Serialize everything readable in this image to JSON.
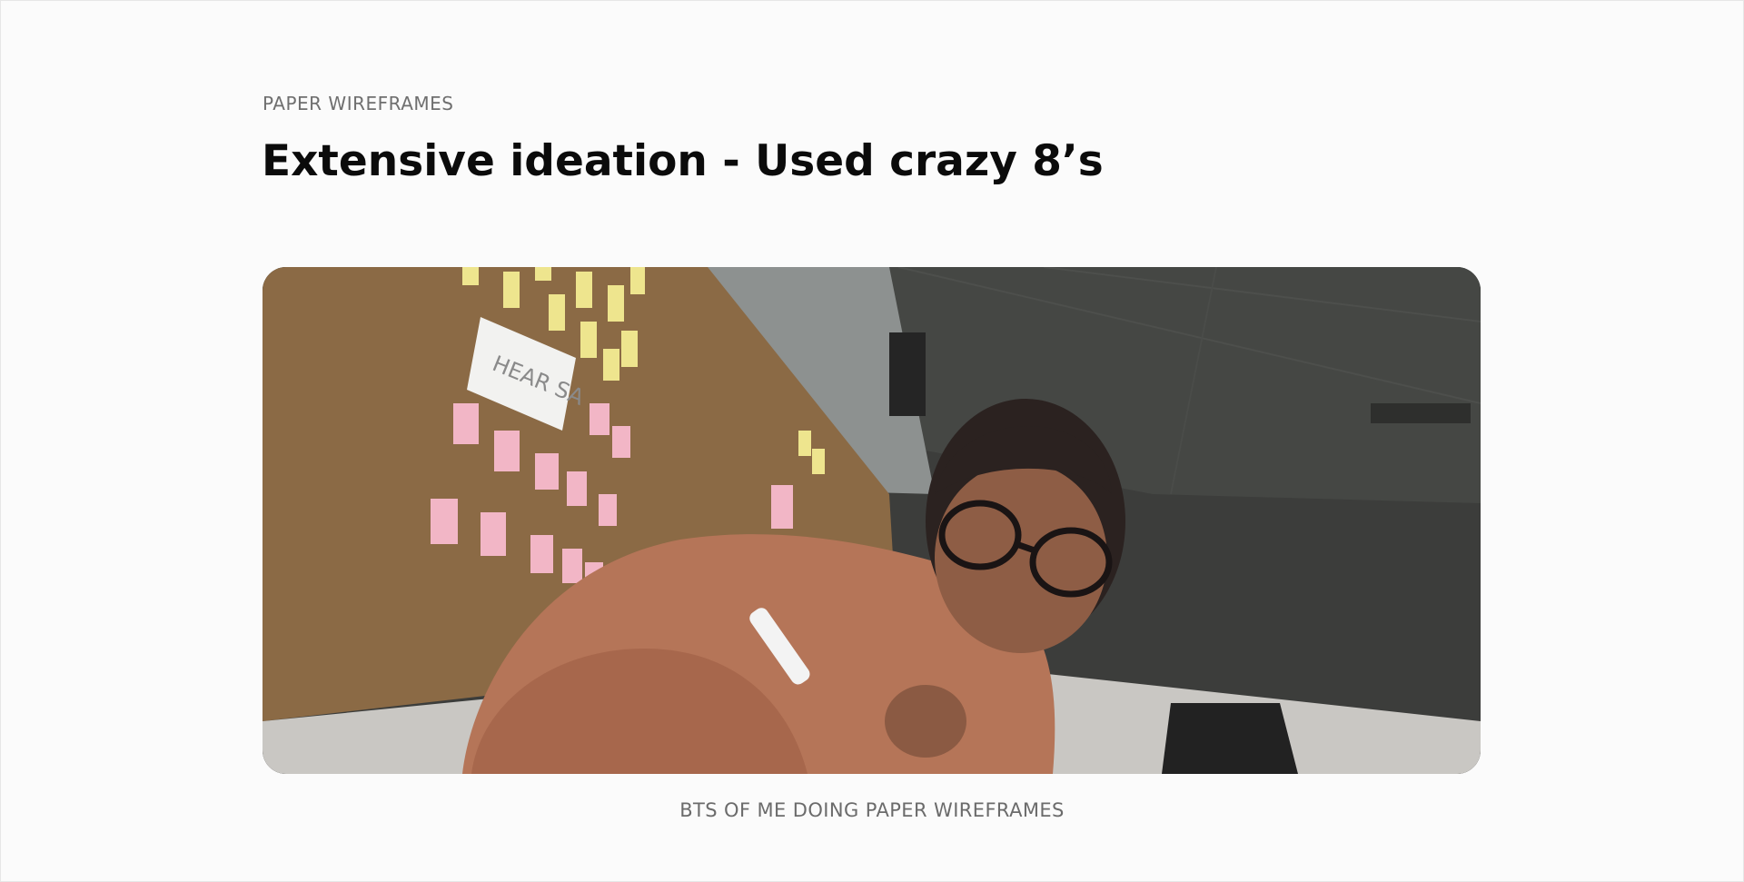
{
  "section": {
    "eyebrow": "PAPER WIREFRAMES",
    "title": "Extensive ideation - Used crazy 8’s"
  },
  "media": {
    "caption": "BTS OF ME DOING PAPER WIREFRAMES",
    "sign_text": "HEAR SA",
    "colors": {
      "corkboard": "#8b6a45",
      "sticky_yellow": "#eee58e",
      "sticky_pink": "#f2b6c6",
      "sweater": "#b57558",
      "ceiling": "#3c3d3b"
    }
  }
}
